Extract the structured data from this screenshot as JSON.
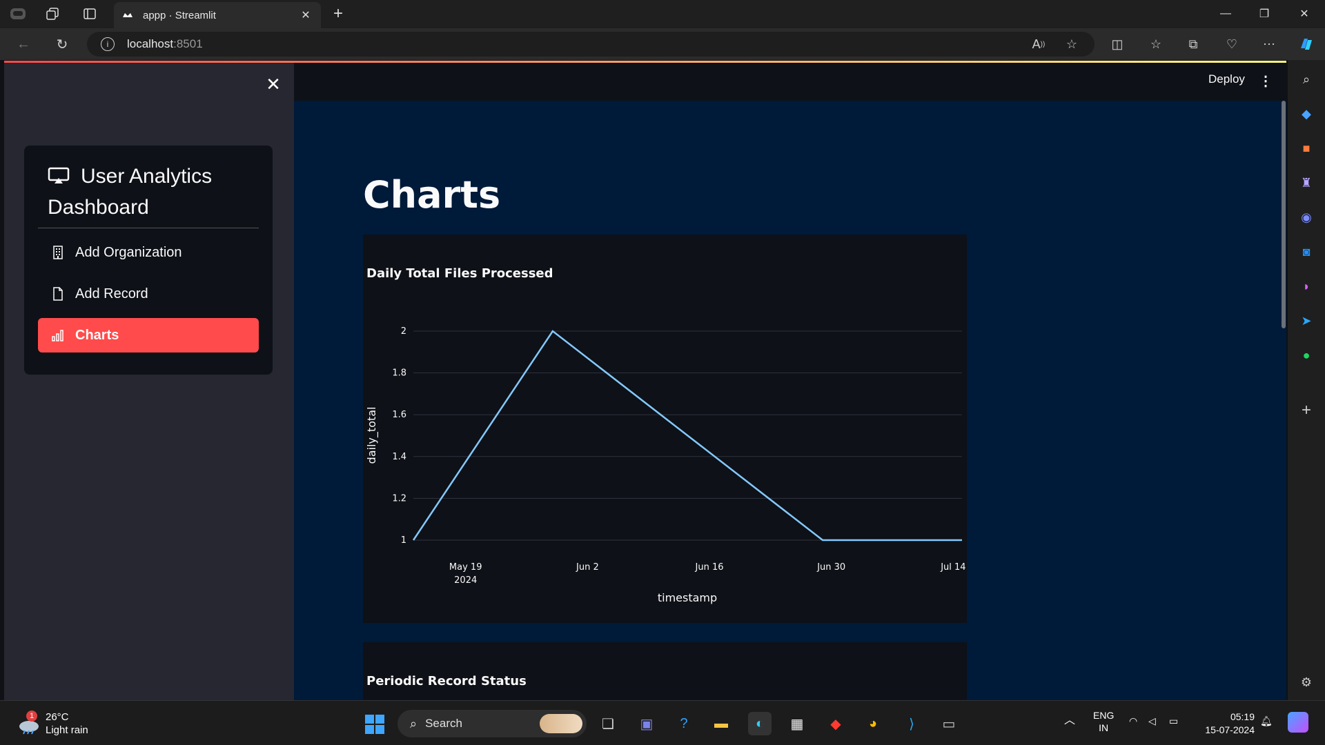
{
  "browser": {
    "tab_title": "appp · Streamlit",
    "url_host": "localhost",
    "url_port": ":8501"
  },
  "sidebar": {
    "title": "User Analytics Dashboard",
    "items": [
      {
        "label": "Add Organization",
        "icon": "building-icon",
        "active": false
      },
      {
        "label": "Add Record",
        "icon": "file-icon",
        "active": false
      },
      {
        "label": "Charts",
        "icon": "bar-chart-icon",
        "active": true
      }
    ]
  },
  "header": {
    "deploy_label": "Deploy"
  },
  "main": {
    "page_title": "Charts"
  },
  "chart_data": [
    {
      "type": "line",
      "title": "Daily Total Files Processed",
      "xlabel": "timestamp",
      "ylabel": "daily_total",
      "x": [
        "2024-05-13",
        "2024-05-29",
        "2024-06-29",
        "2024-07-15"
      ],
      "values": [
        1,
        2,
        1,
        1
      ],
      "xticks": [
        "May 19\n2024",
        "Jun 2",
        "Jun 16",
        "Jun 30",
        "Jul 14"
      ],
      "yticks": [
        "1",
        "1.2",
        "1.4",
        "1.6",
        "1.8",
        "2"
      ],
      "ylim": [
        1,
        2
      ],
      "color": "#83c9ff",
      "grid": true
    },
    {
      "type": "unknown",
      "title": "Periodic Record Status"
    }
  ],
  "taskbar": {
    "weather_temp": "26°C",
    "weather_desc": "Light rain",
    "weather_badge": "1",
    "search_label": "Search",
    "lang_top": "ENG",
    "lang_bottom": "IN",
    "time": "05:19",
    "date": "15-07-2024"
  }
}
